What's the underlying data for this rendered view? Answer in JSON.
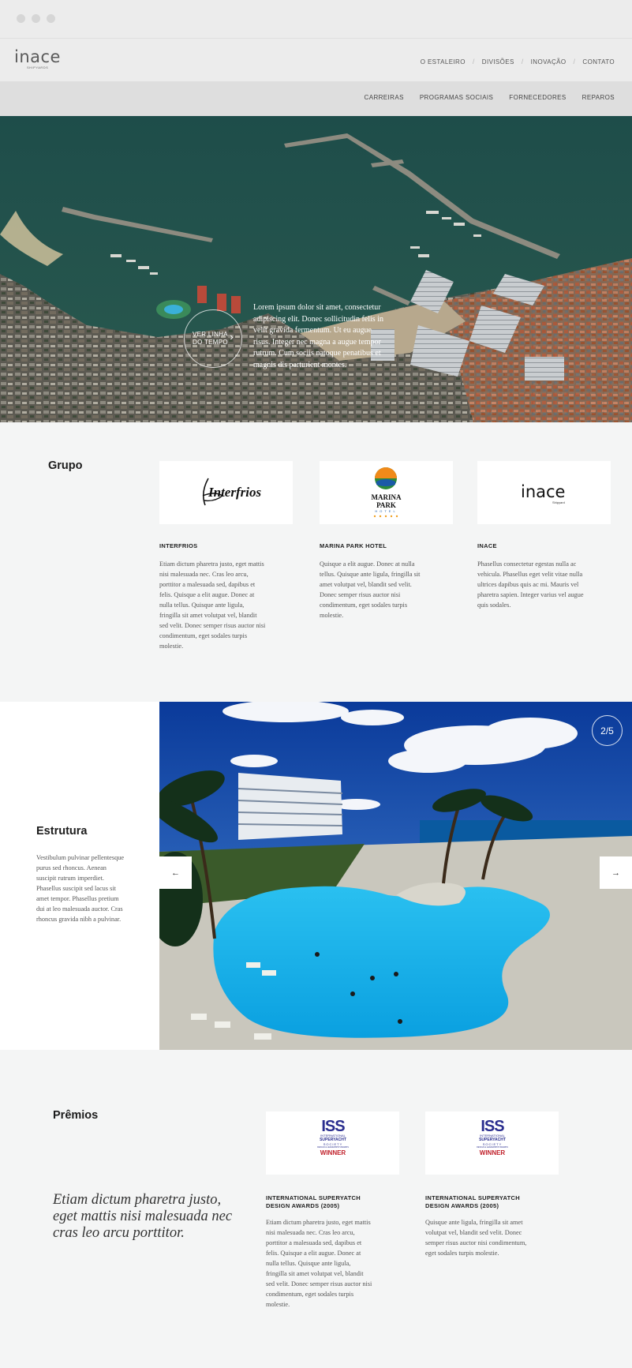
{
  "header": {
    "logo": {
      "name": "inace",
      "tagline": "SHIPYARDS"
    },
    "top_nav": [
      "O ESTALEIRO",
      "DIVISÕES",
      "INOVAÇÃO",
      "CONTATO"
    ],
    "sub_nav": [
      "CARREIRAS",
      "PROGRAMAS SOCIAIS",
      "FORNECEDORES",
      "REPAROS"
    ]
  },
  "hero": {
    "timeline_button": "VER LINHA DO TEMPO",
    "text": "Lorem ipsum dolor sit amet, consectetur adipiscing elit. Donec sollicitudin felis in velit gravida fermentum. Ut eu augue risus. Integer nec magna a augue tempor rutrum. Cum sociis natoque penatibus et magnis dis parturient montes."
  },
  "grupo": {
    "title": "Grupo",
    "cards": [
      {
        "logo": "Interfrios",
        "title": "INTERFRIOS",
        "text": "Etiam dictum pharetra justo, eget mattis nisi malesuada nec. Cras leo arcu, porttitor a malesuada sed, dapibus et felis. Quisque a elit augue. Donec at nulla tellus. Quisque ante ligula, fringilla sit amet volutpat vel, blandit sed velit. Donec semper risus auctor nisi condimentum, eget sodales turpis molestie."
      },
      {
        "logo_line1": "MARINA",
        "logo_line2": "PARK",
        "logo_line3": "HOTEL",
        "title": "MARINA PARK HOTEL",
        "text": "Quisque a elit augue. Donec at nulla tellus. Quisque ante ligula, fringilla sit amet volutpat vel, blandit sed velit. Donec semper risus auctor nisi condimentum, eget sodales turpis molestie."
      },
      {
        "logo": "inace",
        "logo_sub": "Shipyard",
        "title": "INACE",
        "text": "Phasellus consectetur egestas nulla ac vehicula. Phasellus eget velit vitae nulla ultrices dapibus quis ac mi. Mauris vel pharetra sapien. Integer varius vel augue quis sodales."
      }
    ]
  },
  "estrutura": {
    "title": "Estrutura",
    "text": "Vestibulum pulvinar pellentesque purus sed rhoncus. Aenean suscipit rutrum imperdiet. Phasellus suscipit sed lacus sit amet tempor. Phasellus pretium dui at leo malesuada auctor. Cras rhoncus gravida nibh a pulvinar.",
    "counter": "2/5",
    "progress": {
      "current": 2,
      "total": 5
    },
    "prev_icon": "arrow-left-icon",
    "next_icon": "arrow-right-icon"
  },
  "premios": {
    "title": "Prêmios",
    "quote": "Etiam dictum pharetra justo, eget mattis nisi malesuada nec cras leo arcu porttitor.",
    "awards": [
      {
        "logo_top": "ISS",
        "logo_l1": "INTERNATIONAL",
        "logo_l2": "SUPERYACHT",
        "logo_l3": "SOCIETY",
        "logo_l4": "DESIGN & LEADERSHIP AWARDS",
        "logo_l5": "WINNER",
        "title_line1": "INTERNATIONAL SUPERYATCH",
        "title_line2": "DESIGN AWARDS (2005)",
        "text": "Etiam dictum pharetra justo, eget mattis nisi malesuada nec. Cras leo arcu, porttitor a malesuada sed, dapibus et felis. Quisque a elit augue. Donec at nulla tellus. Quisque ante ligula, fringilla sit amet volutpat vel, blandit sed velit. Donec semper risus auctor nisi condimentum, eget sodales turpis molestie."
      },
      {
        "logo_top": "ISS",
        "logo_l1": "INTERNATIONAL",
        "logo_l2": "SUPERYACHT",
        "logo_l3": "SOCIETY",
        "logo_l4": "DESIGN & LEADERSHIP AWARDS",
        "logo_l5": "WINNER",
        "title_line1": "INTERNATIONAL SUPERYATCH",
        "title_line2": "DESIGN AWARDS (2005)",
        "text": "Quisque ante ligula, fringilla sit amet volutpat vel, blandit sed velit. Donec semper risus auctor nisi condimentum, eget sodales turpis molestie."
      }
    ]
  },
  "colors": {
    "header_bg": "#ececec",
    "subnav_bg": "#dedede",
    "page_bg": "#f4f5f5",
    "sea": "#1f4a48",
    "pool": "#1fb5ea",
    "iss_blue": "#2a2e8f",
    "iss_red": "#c0202a"
  }
}
